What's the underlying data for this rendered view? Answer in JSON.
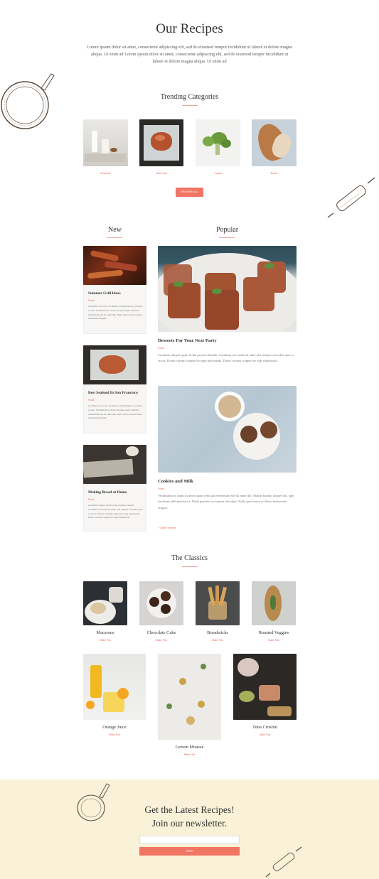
{
  "header": {
    "title": "Our Recipes",
    "intro": "Lorem ipsum dolor sit amet, consectetur adipiscing elit, sed do eiusmod tempor incididunt ut labore et dolore magna aliqua. Ut enim ad Lorem ipsum dolor sit amet, consectetur adipiscing elit, sed do eiusmod tempor incididunt ut labore et dolore magna aliqua. Ut enim ad"
  },
  "trending": {
    "title": "Trending Categories",
    "categories": [
      {
        "label": "Desserts"
      },
      {
        "label": "Sea Food"
      },
      {
        "label": "Vegan"
      },
      {
        "label": "Bread"
      }
    ],
    "browse_label": "BROWSE ALL"
  },
  "new": {
    "title": "New",
    "cards": [
      {
        "title": "Summer Grill Ideas",
        "category": "Food",
        "excerpt": "Curabitur arcu erat, accumsan id imperdiet et, porttitor at sem. Vestibulum ac diam sit amet quam vehicula elementum sed sit amet dui. Nulla quis lorem ut libero malesuada feugiat."
      },
      {
        "title": "Best Seafood In San Francisco",
        "category": "Food",
        "excerpt": "Curabitur arcu erat, accumsan id imperdiet et, porttitor at sem. Vestibulum ac diam sit amet quam vehicula elementum sed sit amet dui. Nulla quis lorem ut libero malesuada feugiat."
      },
      {
        "title": "Making Bread at Home",
        "category": "Food",
        "excerpt": "Curabitur aliquet quam id dui posuere blandit. Curabitur non nulla sit amet nisl tempus convallis quis ac lectus. Donec rutrum congue leo eget malesuada. Donec rutrum congue leo eget malesuada."
      }
    ]
  },
  "popular": {
    "title": "Popular",
    "posts": [
      {
        "title": "Desserts For Your Next Party",
        "category": "Food",
        "excerpt": "Curabitur aliquet quam id dui posuere blandit. Curabitur non nulla sit amet nisl tempus convallis quis ac lectus. Donec rutrum congue leo eget malesuada. Donec rutrum congue leo eget malesuada."
      },
      {
        "title": "Cookies and Milk",
        "category": "Food",
        "excerpt": "Vestibulum ac diam sit amet quam vehicula elementum sed sit amet dui. Mauris blandit aliquet elit, eget tincidunt nibh pulvinar a. Nulla porttitor accumsan tincidunt. Nulla quis lorem ut libero malesuada feugiat."
      }
    ],
    "older_label": "« Older Entries"
  },
  "classics": {
    "title": "The Classics",
    "link_label": "Make This",
    "items": [
      {
        "name": "Macarons"
      },
      {
        "name": "Chocolate Cake"
      },
      {
        "name": "Breadsticks"
      },
      {
        "name": "Roasted Veggies"
      },
      {
        "name": "Orange Juice"
      },
      {
        "name": "Lemon Mousse"
      },
      {
        "name": "Tuna Crostini"
      }
    ]
  },
  "newsletter": {
    "line1": "Get the Latest Recipes!",
    "line2": "Join our newsletter.",
    "input_value": "",
    "send_label": "SEND"
  },
  "colors": {
    "accent": "#f07562",
    "link": "#e5664f",
    "newsletter_bg": "#faf2d8"
  }
}
